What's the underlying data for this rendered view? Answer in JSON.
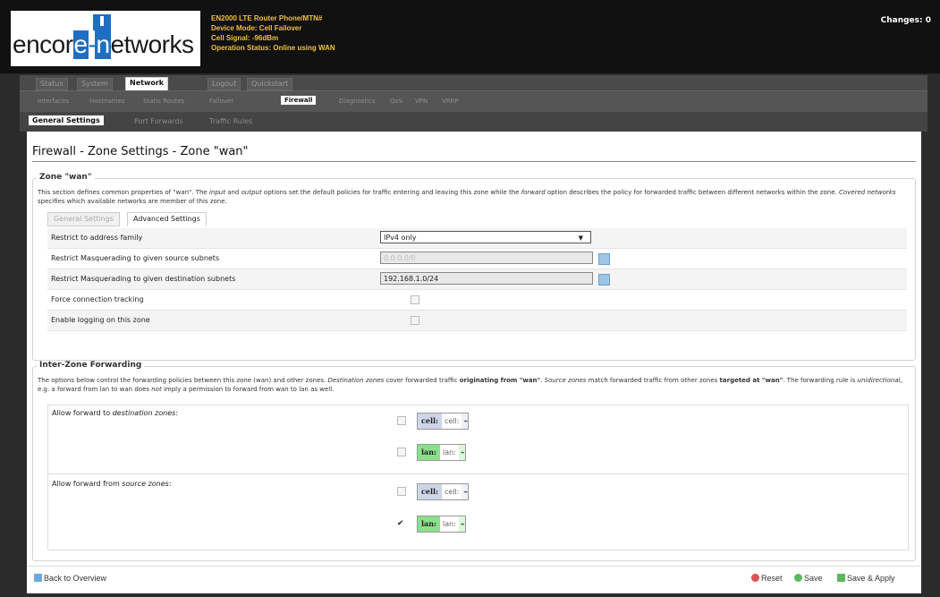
{
  "header": {
    "logo_left": "encor",
    "logo_e": "e",
    "logo_dash": "-",
    "logo_n": "n",
    "logo_right": "etworks",
    "device_line": "EN2000 LTE Router Phone/MTN#",
    "mode_line": "Device Mode: Cell Failover",
    "signal_line": "Cell Signal: -96dBm",
    "status_line": "Operation Status: Online using WAN",
    "changes": "Changes: 0"
  },
  "top_tabs": [
    "Status",
    "System",
    "Network",
    "Logout",
    "Quickstart"
  ],
  "network_tabs": [
    "Interfaces",
    "Hostnames",
    "Static Routes",
    "Failover",
    "Firewall",
    "Diagnostics",
    "QoS",
    "VPN",
    "VRRP"
  ],
  "firewall_tabs": [
    "General Settings",
    "Port Forwards",
    "Traffic Rules"
  ],
  "page_title": "Firewall - Zone Settings - Zone \"wan\"",
  "zone_section": {
    "legend": "Zone \"wan\"",
    "description_parts": [
      "This section defines common properties of \"wan\". The ",
      "input",
      " and ",
      "output",
      " options set the default policies for traffic entering and leaving this zone while the ",
      "forward",
      " option describes the policy for forwarded traffic between different networks within the zone. ",
      "Covered networks",
      " specifies which available networks are member of this zone."
    ],
    "subtabs": [
      "General Settings",
      "Advanced Settings"
    ],
    "rows": [
      {
        "label": "Restrict to address family",
        "value": "IPv4 only"
      },
      {
        "label": "Restrict Masquerading to given source subnets",
        "value": "0.0.0.0/0"
      },
      {
        "label": "Restrict Masquerading to given destination subnets",
        "value": "192.168.1.0/24"
      },
      {
        "label": "Force connection tracking"
      },
      {
        "label": "Enable logging on this zone"
      }
    ]
  },
  "forwarding_section": {
    "legend": "Inter-Zone Forwarding",
    "description_parts": [
      "The options below control the forwarding policies between this zone (wan) and other zones. ",
      "Destination zones",
      " cover forwarded traffic ",
      "originating from \"wan\"",
      ". ",
      "Source zones",
      " match forwarded traffic from other zones ",
      "targeted at \"wan\"",
      ". The forwarding rule is ",
      "unidirectional",
      ", e.g. a forward from lan to wan does ",
      "not",
      " imply a permission to forward from wan to lan as well."
    ],
    "dest_label_prefix": "Allow forward to ",
    "dest_label_em": "destination zones",
    "dest_label_suffix": ":",
    "src_label_prefix": "Allow forward from ",
    "src_label_em": "source zones",
    "src_label_suffix": ":",
    "dest_zones": [
      {
        "name": "cell:",
        "net": "cell:",
        "checked": false
      },
      {
        "name": "lan:",
        "net": "lan:",
        "checked": false
      }
    ],
    "src_zones": [
      {
        "name": "cell:",
        "net": "cell:",
        "checked": false
      },
      {
        "name": "lan:",
        "net": "lan:",
        "checked": true
      }
    ]
  },
  "footer": {
    "back": "Back to Overview",
    "reset": "Reset",
    "save": "Save",
    "save_apply": "Save & Apply"
  },
  "colors": {
    "header_bg": "#111111",
    "device_info": "#f0c040",
    "logo_blue": "#1e6fc2",
    "lan_green": "#8ae08a",
    "cell_blue": "#cdd6e8"
  }
}
